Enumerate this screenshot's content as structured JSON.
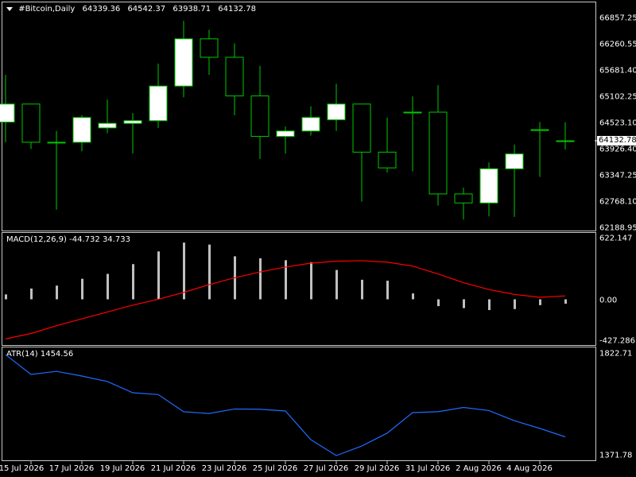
{
  "main_pane": {
    "symbol": "#Bitcoin,Daily",
    "ohlc": [
      "64339.36",
      "64542.37",
      "63938.71",
      "64132.78"
    ],
    "price_tag": "64132.78",
    "price_labels": [
      "66857.25",
      "66260.55",
      "65681.40",
      "65102.25",
      "64523.10",
      "63926.40",
      "63347.25",
      "62768.10",
      "62188.95"
    ]
  },
  "macd_pane": {
    "title": "MACD(12,26,9)",
    "values": [
      "-44.732",
      "34.733"
    ],
    "axis_labels": [
      "622.147",
      "0.00",
      "-427.286"
    ]
  },
  "atr_pane": {
    "title": "ATR(14)",
    "value": "1454.56",
    "axis_labels": [
      "1822.71",
      "1371.78"
    ]
  },
  "time_axis": {
    "labels": [
      "15 Jul 2026",
      "17 Jul 2026",
      "19 Jul 2026",
      "21 Jul 2026",
      "23 Jul 2026",
      "25 Jul 2026",
      "27 Jul 2026",
      "29 Jul 2026",
      "31 Jul 2026",
      "2 Aug 2026",
      "4 Aug 2026"
    ]
  },
  "colors": {
    "background": "#000000",
    "candle_body": "#ffffff",
    "candle_wick": "#00c800",
    "histogram": "#c0c0c0",
    "signal_line": "#ff0000",
    "atr_line": "#1e6bff",
    "border": "#c8c8c8"
  },
  "chart_data": [
    {
      "type": "candlestick",
      "title": "#Bitcoin,Daily",
      "ylim": [
        62188.95,
        66857.25
      ],
      "x": [
        "14 Jul 2026",
        "15 Jul 2026",
        "16 Jul 2026",
        "17 Jul 2026",
        "18 Jul 2026",
        "19 Jul 2026",
        "20 Jul 2026",
        "21 Jul 2026",
        "22 Jul 2026",
        "23 Jul 2026",
        "24 Jul 2026",
        "25 Jul 2026",
        "26 Jul 2026",
        "27 Jul 2026",
        "28 Jul 2026",
        "29 Jul 2026",
        "30 Jul 2026",
        "31 Jul 2026",
        "1 Aug 2026",
        "2 Aug 2026",
        "3 Aug 2026",
        "4 Aug 2026",
        "5 Aug 2026"
      ],
      "open": [
        64550,
        64950,
        64100,
        64100,
        64420,
        64520,
        64580,
        65350,
        66400,
        65990,
        65130,
        64230,
        64350,
        64600,
        64950,
        63880,
        64770,
        64770,
        62950,
        62750,
        63510,
        64380,
        64132.78
      ],
      "high": [
        65600,
        64950,
        64350,
        64700,
        65050,
        64750,
        65850,
        66800,
        66600,
        66300,
        65800,
        64450,
        64900,
        65400,
        64950,
        64650,
        65120,
        65370,
        63090,
        63650,
        64050,
        64550,
        64542.37
      ],
      "low": [
        64100,
        63950,
        62600,
        63900,
        64300,
        63850,
        64420,
        65100,
        65600,
        64700,
        63730,
        63850,
        64250,
        64350,
        62780,
        63430,
        63450,
        62690,
        62380,
        62450,
        62440,
        63330,
        63938.71
      ],
      "close": [
        64950,
        64100,
        64100,
        64650,
        64520,
        64580,
        65350,
        66400,
        65990,
        65130,
        64230,
        64350,
        64650,
        64950,
        63880,
        63530,
        64770,
        62950,
        62750,
        63510,
        63840,
        64380,
        64132.78
      ]
    },
    {
      "type": "bar",
      "title": "MACD(12,26,9)",
      "ylim": [
        -427.286,
        622.147
      ],
      "series": [
        {
          "name": "MACD",
          "values": [
            50,
            110,
            140,
            210,
            260,
            360,
            490,
            580,
            560,
            440,
            420,
            400,
            380,
            300,
            200,
            190,
            60,
            -70,
            -90,
            -110,
            -100,
            -60,
            -44.732
          ]
        },
        {
          "name": "Signal",
          "values": [
            -405,
            -350,
            -270,
            -200,
            -130,
            -60,
            0,
            70,
            150,
            220,
            280,
            330,
            370,
            390,
            395,
            380,
            340,
            260,
            170,
            100,
            50,
            20,
            34.733
          ]
        }
      ]
    },
    {
      "type": "line",
      "title": "ATR(14)",
      "ylim": [
        1371.78,
        1822.71
      ],
      "series": [
        {
          "name": "ATR",
          "values": [
            1819,
            1731,
            1745,
            1724,
            1700,
            1650,
            1642,
            1566,
            1558,
            1578,
            1577,
            1569,
            1442,
            1371.78,
            1414,
            1471,
            1562,
            1566,
            1585,
            1571,
            1526,
            1492,
            1454.56
          ]
        }
      ]
    }
  ]
}
